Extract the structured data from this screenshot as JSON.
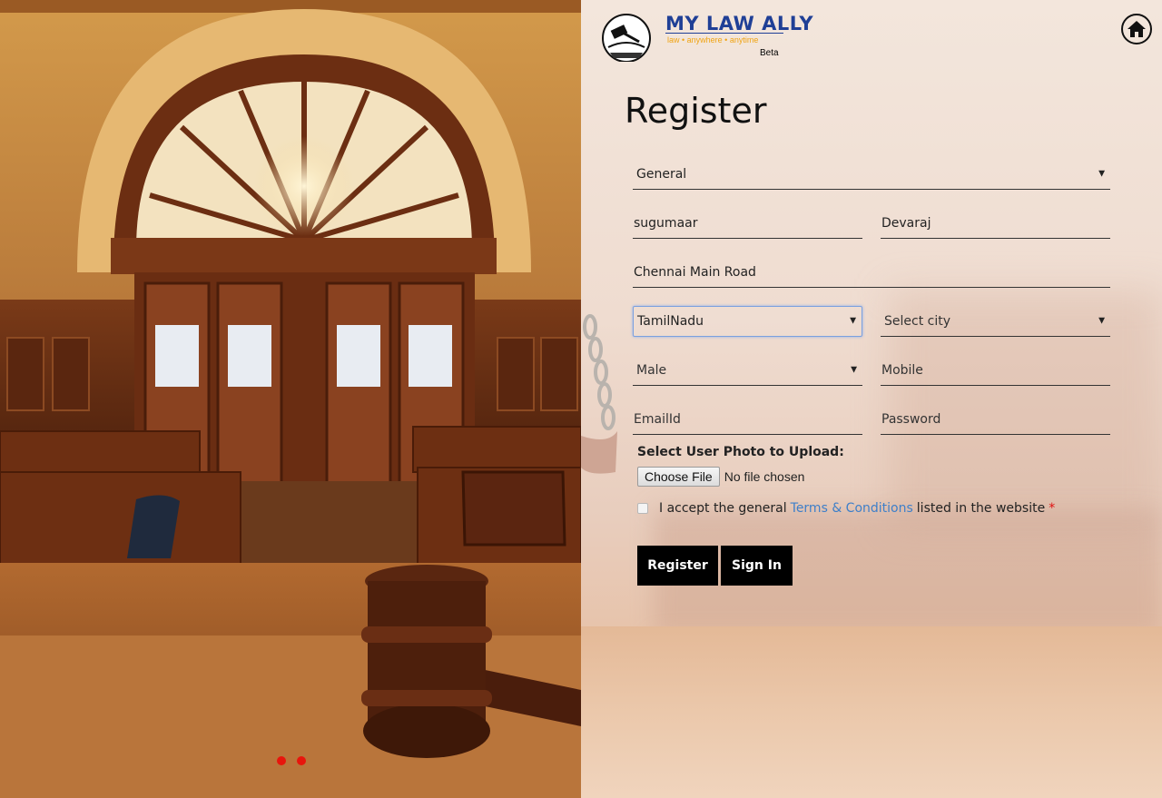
{
  "brand": {
    "name": "MY LAW ALLY",
    "tagline": "law  •  anywhere  •  anytime",
    "badge": "Beta"
  },
  "page": {
    "title": "Register"
  },
  "form": {
    "category": {
      "value": "General"
    },
    "first_name": {
      "value": "sugumaar"
    },
    "last_name": {
      "value": "Devaraj"
    },
    "address": {
      "value": "Chennai Main Road"
    },
    "state": {
      "value": "TamilNadu"
    },
    "city": {
      "value": "Select city"
    },
    "gender": {
      "value": "Male"
    },
    "mobile": {
      "value": "Mobile"
    },
    "email": {
      "value": "EmailId"
    },
    "password": {
      "value": "Password"
    },
    "upload_label": "Select User Photo to Upload:",
    "file_button": "Choose File",
    "file_status": "No file chosen",
    "terms_prefix": "I accept the general",
    "terms_link": "Terms & Conditions",
    "terms_suffix": "listed in the website",
    "terms_required": "*"
  },
  "buttons": {
    "register": "Register",
    "sign_in": "Sign In"
  },
  "colors": {
    "brand_blue": "#1f3f96",
    "brand_orange": "#f0a414",
    "link_blue": "#3e7fc9",
    "carousel_dot": "#e8150c",
    "button_bg": "#000000"
  },
  "icons": {
    "home": "home-icon",
    "select_arrow": "caret-down-icon"
  },
  "carousel": {
    "slide_count": 2
  }
}
